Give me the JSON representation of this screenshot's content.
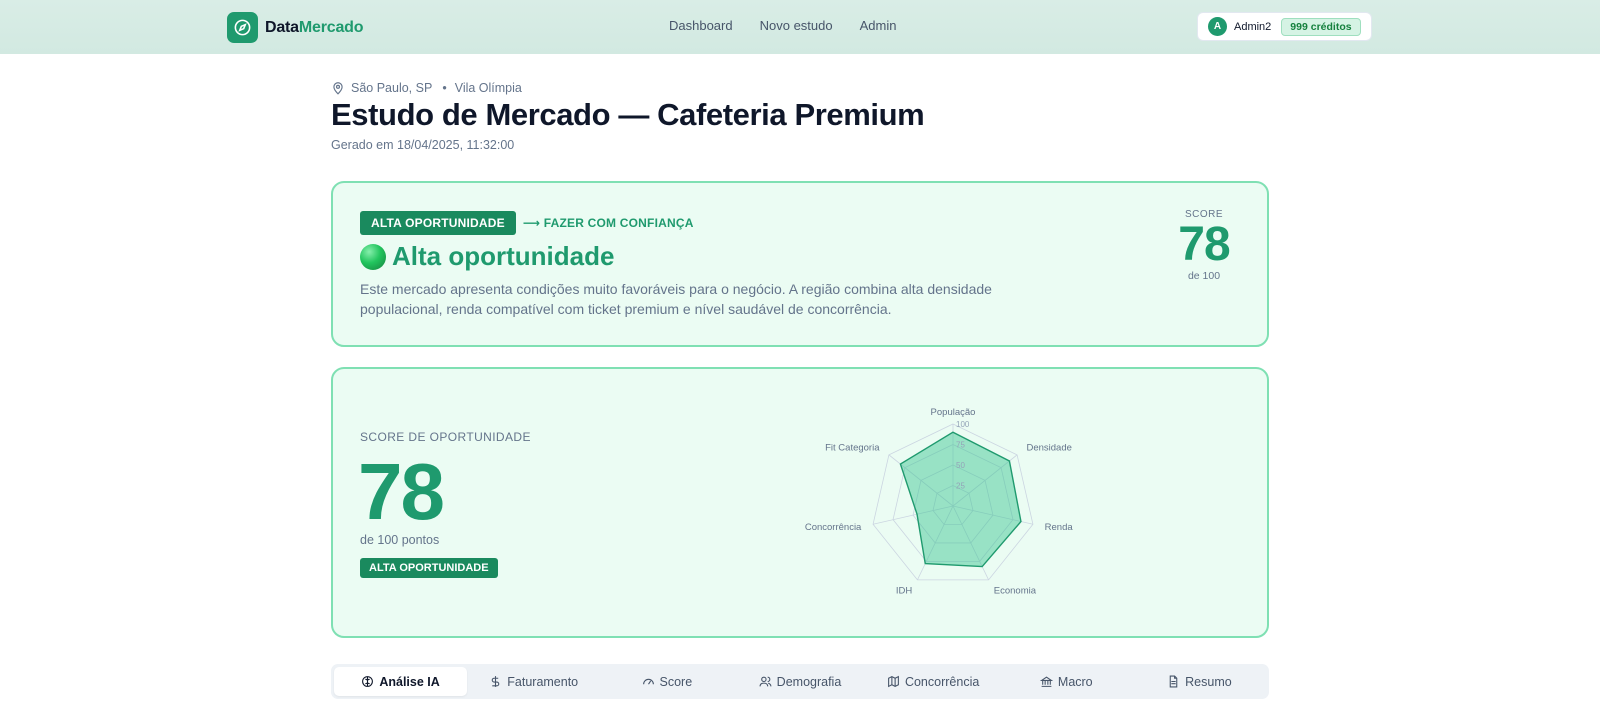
{
  "header": {
    "brand_part1": "Data",
    "brand_part2": "Mercado",
    "nav": [
      "Dashboard",
      "Novo estudo",
      "Admin"
    ],
    "avatar_initial": "A",
    "username": "Admin2",
    "credits": "999 créditos"
  },
  "location": {
    "city": "São Paulo, SP",
    "district": "Vila Olímpia"
  },
  "page_title": "Estudo de Mercado — Cafeteria Premium",
  "generated_at": "Gerado em 18/04/2025, 11:32:00",
  "verdict_card": {
    "badge": "ALTA OPORTUNIDADE",
    "action": "⟶ FAZER COM CONFIANÇA",
    "verdict": "Alta oportunidade",
    "description": "Este mercado apresenta condições muito favoráveis para o negócio. A região combina alta densidade populacional, renda compatível com ticket premium e nível saudável de concorrência.",
    "score_label": "SCORE",
    "score": "78",
    "score_sub": "de 100"
  },
  "score_card": {
    "label": "SCORE DE OPORTUNIDADE",
    "score": "78",
    "sub": "de 100 pontos",
    "badge": "ALTA OPORTUNIDADE"
  },
  "chart_data": {
    "type": "radar",
    "axes": [
      "População",
      "Densidade",
      "Renda",
      "Economia",
      "IDH",
      "Concorrência",
      "Fit Categoria"
    ],
    "values": [
      90,
      88,
      85,
      82,
      78,
      45,
      82
    ],
    "rmax": 100,
    "ticks": [
      "25",
      "50",
      "75",
      "100"
    ],
    "fill_color": "#34c48e",
    "stroke_color": "#1f9a6e"
  },
  "tabs": [
    {
      "label": "Análise IA",
      "icon": "brain-icon",
      "active": true
    },
    {
      "label": "Faturamento",
      "icon": "dollar-icon",
      "active": false
    },
    {
      "label": "Score",
      "icon": "gauge-icon",
      "active": false
    },
    {
      "label": "Demografia",
      "icon": "users-icon",
      "active": false
    },
    {
      "label": "Concorrência",
      "icon": "map-icon",
      "active": false
    },
    {
      "label": "Macro",
      "icon": "bank-icon",
      "active": false
    },
    {
      "label": "Resumo",
      "icon": "document-icon",
      "active": false
    }
  ]
}
